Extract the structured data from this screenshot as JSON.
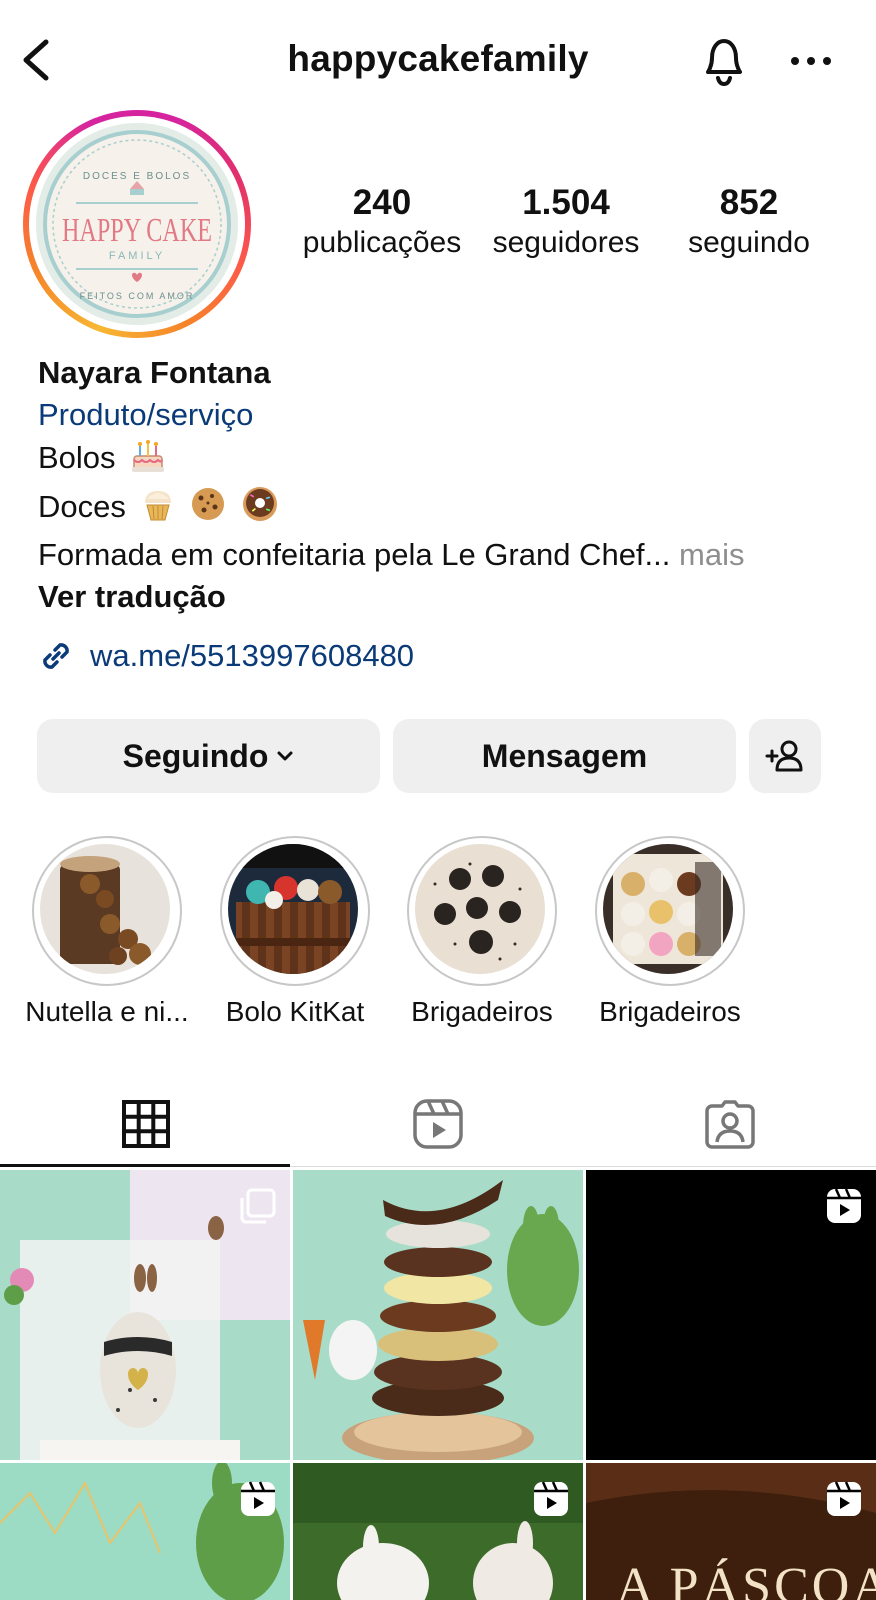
{
  "header": {
    "username": "happycakefamily"
  },
  "avatar": {
    "logo_top": "DOCES E BOLOS",
    "logo_main": "HAPPY CAKE",
    "logo_sub": "FAMILY",
    "logo_bottom": "FEITOS COM AMOR"
  },
  "stats": {
    "posts_count": "240",
    "posts_label": "publicações",
    "followers_count": "1.504",
    "followers_label": "seguidores",
    "following_count": "852",
    "following_label": "seguindo"
  },
  "bio": {
    "name": "Nayara Fontana",
    "category": "Produto/serviço",
    "line1": "Bolos",
    "line2": "Doces",
    "line3": "Formada em confeitaria pela Le Grand Chef...",
    "more": "mais",
    "translate": "Ver tradução"
  },
  "link": {
    "url": "wa.me/5513997608480"
  },
  "actions": {
    "following_label": "Seguindo",
    "message_label": "Mensagem"
  },
  "highlights": [
    {
      "label": "Nutella e ni..."
    },
    {
      "label": "Bolo KitKat"
    },
    {
      "label": "Brigadeiros"
    },
    {
      "label": "Brigadeiros"
    }
  ],
  "grid": {
    "easter_text": "A PÁSCOA"
  },
  "colors": {
    "link_blue": "#0a3b78",
    "button_bg": "#efefef",
    "muted_text": "#8e8e8e"
  }
}
